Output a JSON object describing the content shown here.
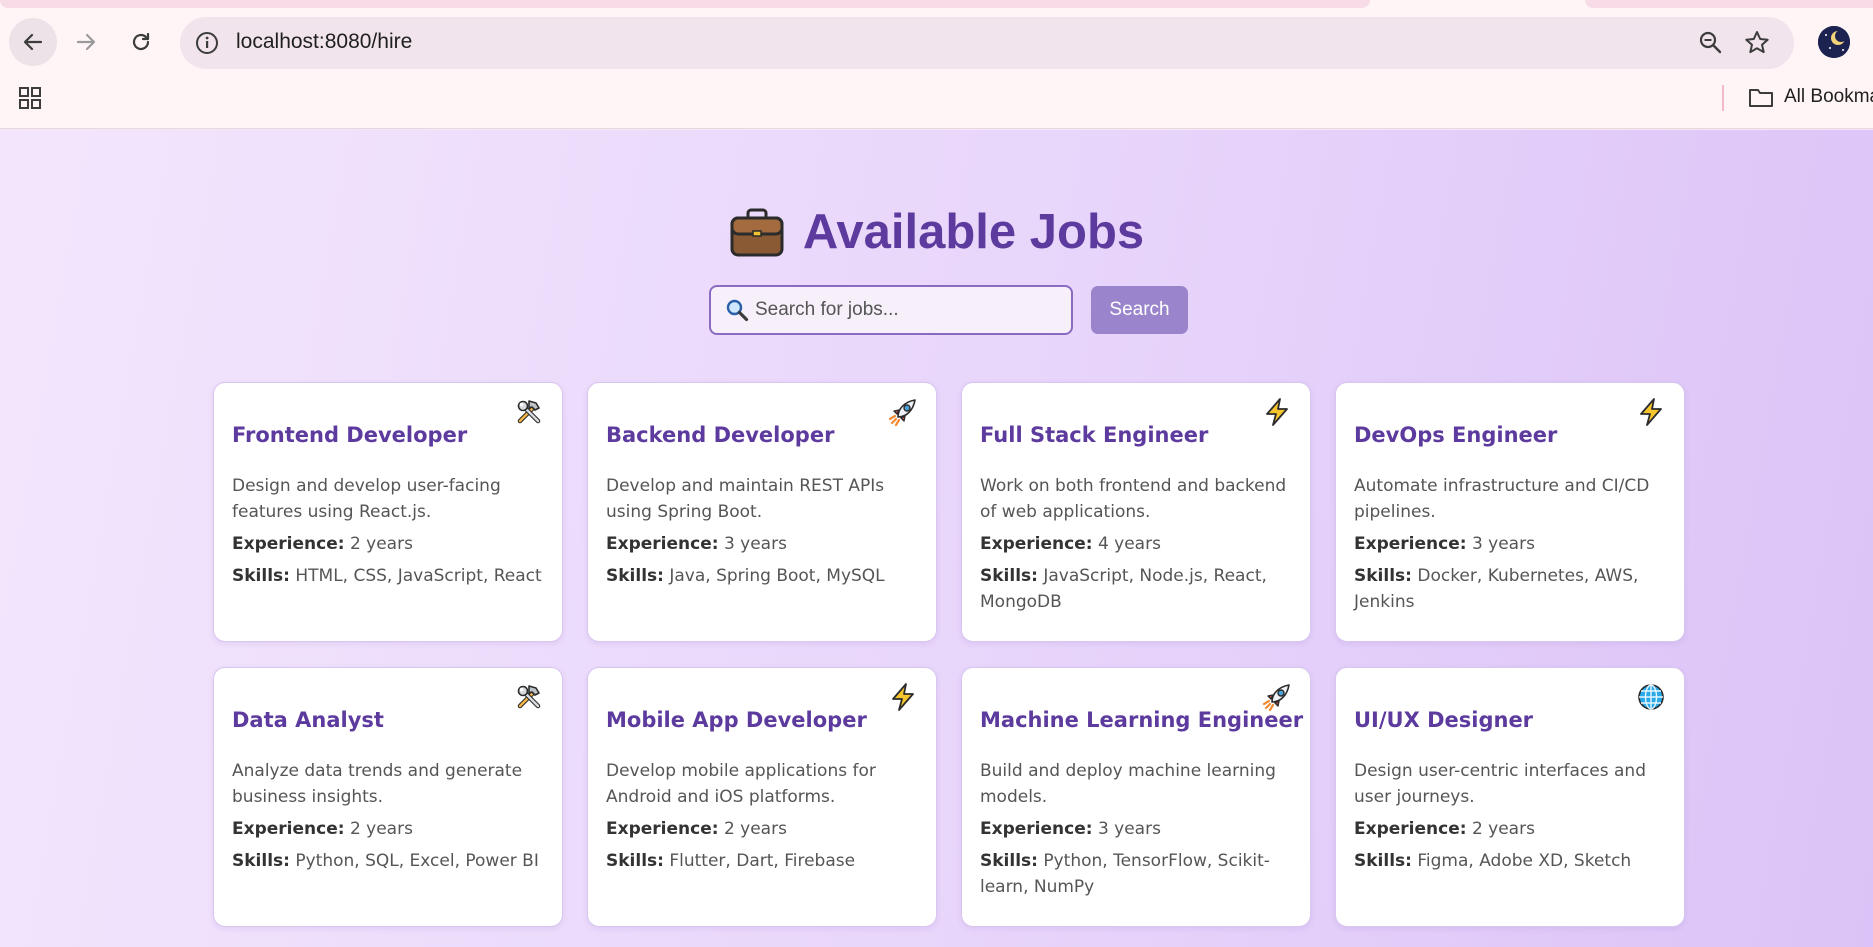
{
  "browser": {
    "url": "localhost:8080/hire",
    "bookmarks_label": "All Bookmarks"
  },
  "page": {
    "title": "Available Jobs",
    "search_placeholder": "Search for jobs...",
    "search_button": "Search",
    "experience_label": "Experience:",
    "skills_label": "Skills:"
  },
  "jobs": [
    {
      "title": "Frontend Developer",
      "icon": "hammer-wrench-icon",
      "description": "Design and develop user-facing features using React.js.",
      "experience": "2 years",
      "skills": "HTML, CSS, JavaScript, React"
    },
    {
      "title": "Backend Developer",
      "icon": "rocket-icon",
      "description": "Develop and maintain REST APIs using Spring Boot.",
      "experience": "3 years",
      "skills": "Java, Spring Boot, MySQL"
    },
    {
      "title": "Full Stack Engineer",
      "icon": "lightning-icon",
      "description": "Work on both frontend and backend of web applications.",
      "experience": "4 years",
      "skills": "JavaScript, Node.js, React, MongoDB"
    },
    {
      "title": "DevOps Engineer",
      "icon": "lightning-icon",
      "description": "Automate infrastructure and CI/CD pipelines.",
      "experience": "3 years",
      "skills": "Docker, Kubernetes, AWS, Jenkins"
    },
    {
      "title": "Data Analyst",
      "icon": "hammer-wrench-icon",
      "description": "Analyze data trends and generate business insights.",
      "experience": "2 years",
      "skills": "Python, SQL, Excel, Power BI"
    },
    {
      "title": "Mobile App Developer",
      "icon": "lightning-icon",
      "description": "Develop mobile applications for Android and iOS platforms.",
      "experience": "2 years",
      "skills": "Flutter, Dart, Firebase"
    },
    {
      "title": "Machine Learning Engineer",
      "icon": "rocket-icon",
      "description": "Build and deploy machine learning models.",
      "experience": "3 years",
      "skills": "Python, TensorFlow, Scikit-learn, NumPy"
    },
    {
      "title": "UI/UX Designer",
      "icon": "globe-icon",
      "description": "Design user-centric interfaces and user journeys.",
      "experience": "2 years",
      "skills": "Figma, Adobe XD, Sketch"
    }
  ],
  "colors": {
    "heading": "#5d3b9e",
    "button": "#9a85cc",
    "card_border": "#d7c6ee"
  }
}
